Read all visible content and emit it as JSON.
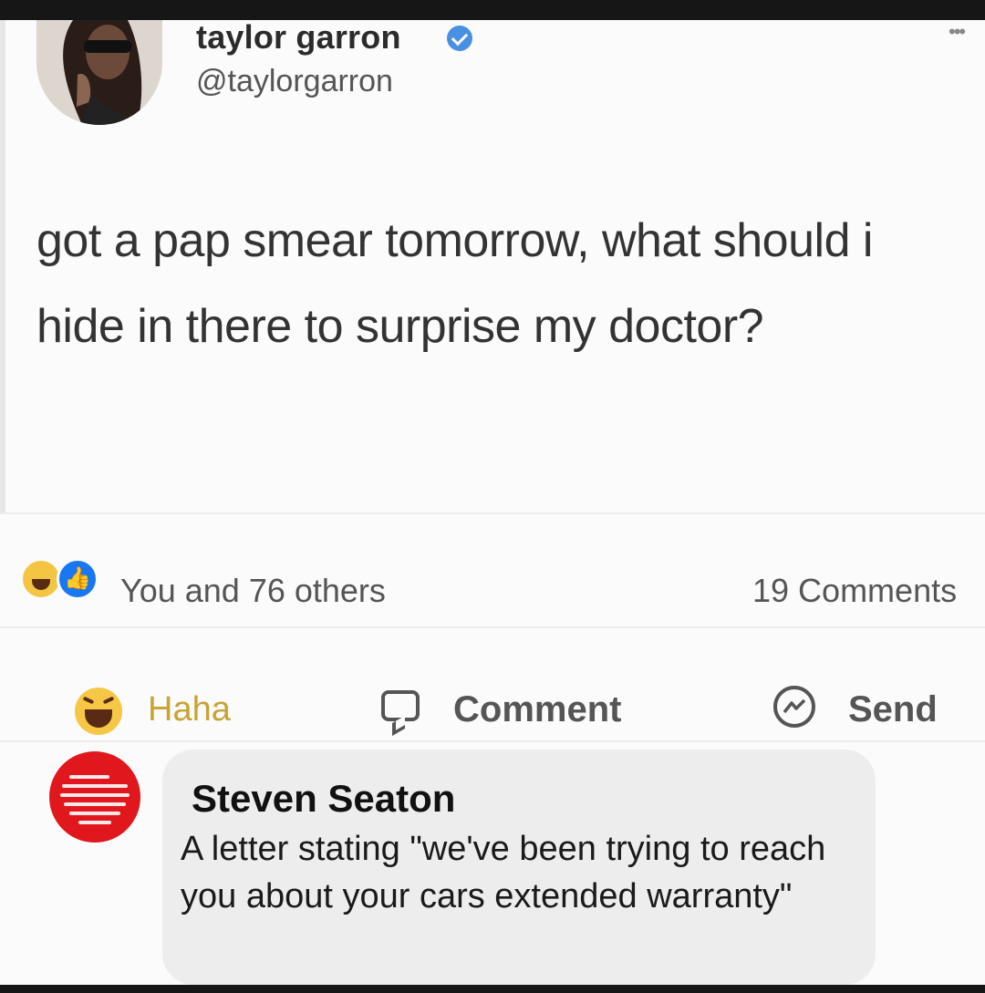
{
  "tweet": {
    "author_name": "taylor garron",
    "handle": "@taylorgarron",
    "more_icon": "ellipsis-icon",
    "verified_icon": "verified-badge-icon",
    "text": "got a pap smear tomorrow, what should i hide in there to surprise my doctor?"
  },
  "reactions": {
    "summary": "You and 76 others",
    "comments_count": "19 Comments",
    "icons": [
      "haha-emoji-icon",
      "like-icon"
    ]
  },
  "actions": {
    "haha_label": "Haha",
    "comment_label": "Comment",
    "send_label": "Send"
  },
  "comment": {
    "author_name": "Steven Seaton",
    "text": "A letter stating \"we've been trying to reach you about your cars extended warranty\""
  },
  "colors": {
    "haha_yellow": "#f6c645",
    "haha_text": "#c8a436",
    "like_blue": "#1877f2",
    "verified_blue": "#4a90e2",
    "commenter_avatar_red": "#e0171d",
    "bubble_gray": "#ededed"
  }
}
